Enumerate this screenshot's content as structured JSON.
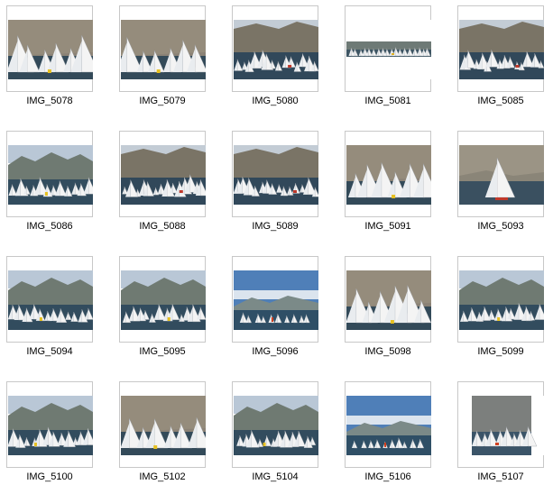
{
  "thumbnails": [
    {
      "label": "IMG_5078",
      "scene": "cliffs-close"
    },
    {
      "label": "IMG_5079",
      "scene": "cliffs-close"
    },
    {
      "label": "IMG_5080",
      "scene": "cliffs-fleet"
    },
    {
      "label": "IMG_5081",
      "scene": "panorama"
    },
    {
      "label": "IMG_5085",
      "scene": "cliffs-fleet"
    },
    {
      "label": "IMG_5086",
      "scene": "sky-fleet"
    },
    {
      "label": "IMG_5088",
      "scene": "cliffs-fleet"
    },
    {
      "label": "IMG_5089",
      "scene": "cliffs-fleet"
    },
    {
      "label": "IMG_5091",
      "scene": "cliffs-close"
    },
    {
      "label": "IMG_5093",
      "scene": "single-sail"
    },
    {
      "label": "IMG_5094",
      "scene": "sky-fleet"
    },
    {
      "label": "IMG_5095",
      "scene": "sky-fleet"
    },
    {
      "label": "IMG_5096",
      "scene": "blue-sky"
    },
    {
      "label": "IMG_5098",
      "scene": "cliffs-close"
    },
    {
      "label": "IMG_5099",
      "scene": "sky-fleet"
    },
    {
      "label": "IMG_5100",
      "scene": "sky-fleet"
    },
    {
      "label": "IMG_5102",
      "scene": "cliffs-close"
    },
    {
      "label": "IMG_5104",
      "scene": "sky-fleet"
    },
    {
      "label": "IMG_5106",
      "scene": "blue-sky"
    },
    {
      "label": "IMG_5107",
      "scene": "portrait-fleet"
    }
  ],
  "colors": {
    "frame_border": "#c8c8c8",
    "caption_text": "#000000",
    "background": "#ffffff"
  }
}
